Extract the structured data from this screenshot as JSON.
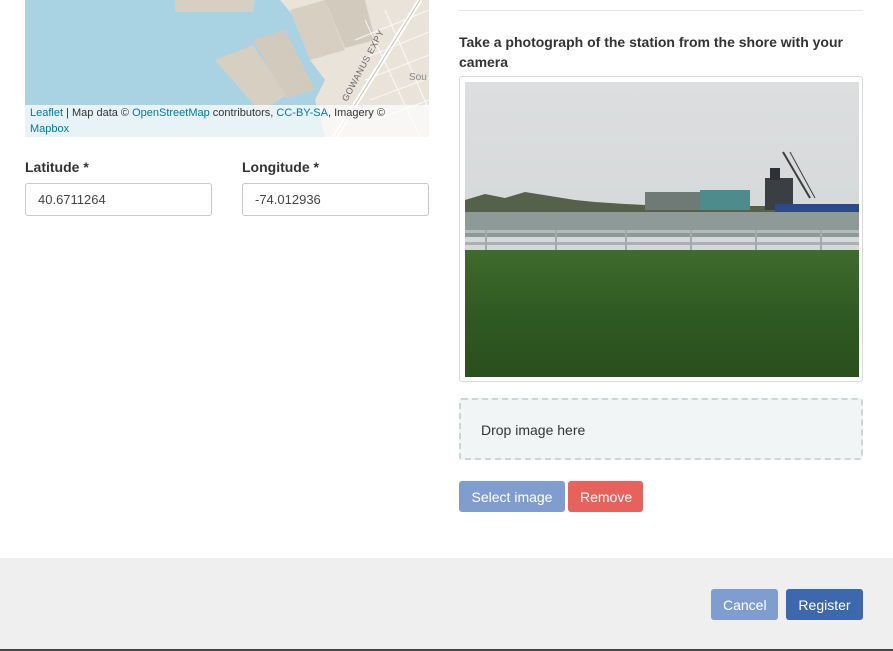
{
  "map": {
    "street_labels": [
      "GOWANUS EXPY",
      "Sou"
    ],
    "attribution": {
      "leaflet": "Leaflet",
      "sep1": " | Map data © ",
      "osm": "OpenStreetMap",
      "sep2": " contributors, ",
      "license": "CC-BY-SA",
      "sep3": ", Imagery ©",
      "mapbox": "Mapbox"
    }
  },
  "location": {
    "latitude_label": "Latitude *",
    "latitude_value": "40.6711264",
    "longitude_label": "Longitude *",
    "longitude_value": "-74.012936"
  },
  "photo": {
    "label": "Take a photograph of the station from the shore with your camera",
    "dropzone_text": "Drop image here",
    "select_label": "Select image",
    "remove_label": "Remove"
  },
  "footer": {
    "cancel_label": "Cancel",
    "register_label": "Register"
  },
  "colors": {
    "primary_light": "#7f9ecf",
    "primary": "#3e68ad",
    "danger": "#e8625d",
    "link": "#0078a8"
  }
}
